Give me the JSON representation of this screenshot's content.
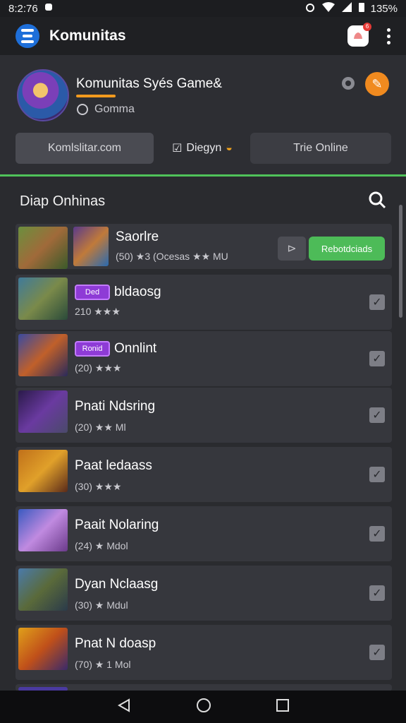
{
  "status": {
    "time": "8:2:76",
    "battery": "135%"
  },
  "app": {
    "title": "Komunitas",
    "logo_icon": "menu-logo-icon",
    "notification_count": "6"
  },
  "profile": {
    "name": "Komunitas Syés Game&",
    "subtitle": "Gomma",
    "accent": "#f29a1e"
  },
  "tabs": [
    {
      "label": "Komlslitar.com"
    },
    {
      "label": "Diegyn"
    },
    {
      "label": "Trie Online"
    }
  ],
  "section": {
    "title": "Diap Onhinas"
  },
  "items": [
    {
      "title": "Saorlre",
      "sub": "(50) ★3 (Ocesas ★★ MU",
      "share": "⊳",
      "action": "Rebotdciads"
    },
    {
      "title": "bldaosg",
      "badge": "Ded",
      "sub": "210 ★★★"
    },
    {
      "title": "Onnlint",
      "badge": "Ronid",
      "sub": "(20) ★★★"
    },
    {
      "title": "Pnati Ndsring",
      "sub": "(20) ★★ Ml"
    },
    {
      "title": "Paat ledaass",
      "sub": "(30) ★★★"
    },
    {
      "title": "Paait Nolaring",
      "sub": "(24) ★ Mdol"
    },
    {
      "title": "Dyan Nclaasg",
      "sub": "(30) ★ Mdul"
    },
    {
      "title": "Pnat N doasp",
      "sub": "(70) ★ 1 Mol"
    }
  ],
  "colors": {
    "green": "#4dbb58",
    "purple_badge": "#8e3bd6",
    "orange": "#f08a1f"
  }
}
